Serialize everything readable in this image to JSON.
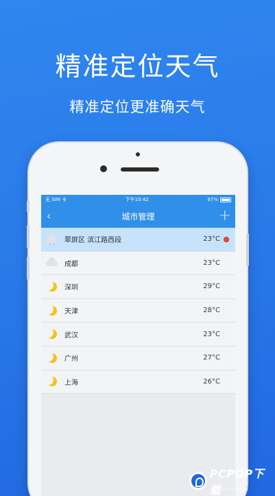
{
  "promo": {
    "headline": "精准定位天气",
    "subline": "精准定位更准确天气"
  },
  "status_bar": {
    "carrier": "无 SIM 卡",
    "time": "下午10:42",
    "battery": "97%",
    "battery_level": 0.97
  },
  "nav": {
    "title": "城市管理",
    "back_icon": "chevron-left-icon",
    "add_icon": "plus-icon"
  },
  "cities": [
    {
      "name": "翠屏区 滨江路西段",
      "temp": "23°C",
      "icon": "cloud-rain-icon",
      "current": true
    },
    {
      "name": "成都",
      "temp": "23°C",
      "icon": "cloud-icon",
      "current": false
    },
    {
      "name": "深圳",
      "temp": "29°C",
      "icon": "moon-icon",
      "current": false
    },
    {
      "name": "天津",
      "temp": "28°C",
      "icon": "moon-icon",
      "current": false
    },
    {
      "name": "武汉",
      "temp": "23°C",
      "icon": "moon-icon",
      "current": false
    },
    {
      "name": "广州",
      "temp": "27°C",
      "icon": "moon-icon",
      "current": false
    },
    {
      "name": "上海",
      "temp": "26°C",
      "icon": "moon-icon",
      "current": false
    }
  ],
  "watermark": {
    "brand": "PCPOP下载",
    "sub": "PCPOP.com download"
  },
  "colors": {
    "background": "#2a7bea",
    "navbar": "#2f8fe9",
    "current_row": "#c7e3fb",
    "pin": "#e04a3b",
    "moon": "#f2c21a"
  }
}
